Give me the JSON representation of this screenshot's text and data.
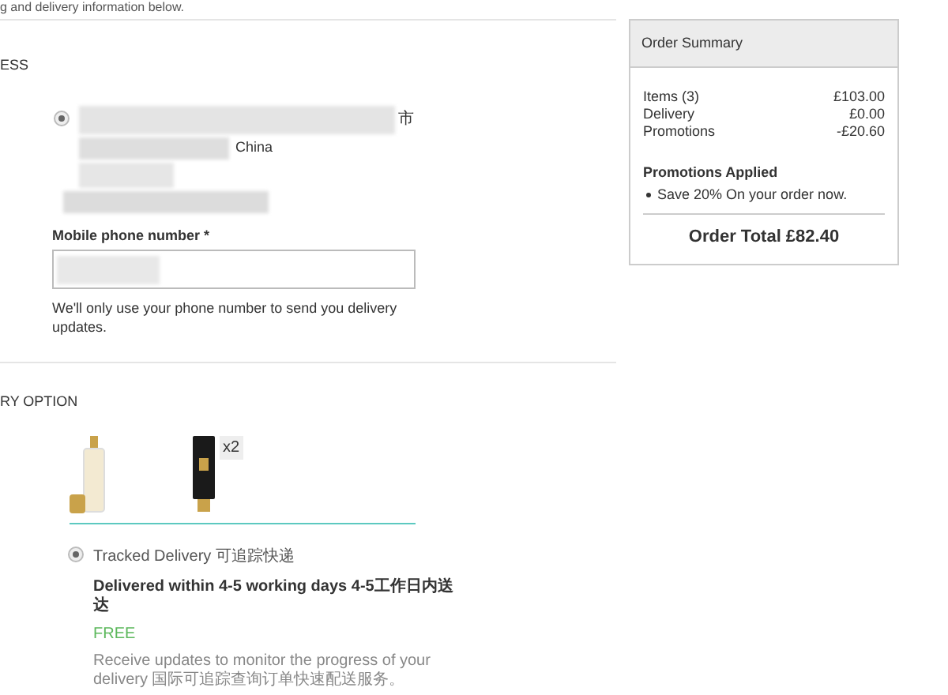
{
  "intro": "g and delivery information below.",
  "address_section": {
    "heading": "ESS",
    "address": {
      "selected": true,
      "city_fragment": "市",
      "country": "China"
    },
    "phone": {
      "label": "Mobile phone number *",
      "note": "We'll only use your phone number to send you delivery updates."
    }
  },
  "delivery_section": {
    "heading": "RY OPTION",
    "products": [
      {
        "kind": "bottle"
      },
      {
        "kind": "tube",
        "quantity": "x2"
      }
    ],
    "options": [
      {
        "selected": true,
        "name": "Tracked Delivery 可追踪快递",
        "timing": "Delivered within 4-5 working days 4-5工作日内送达",
        "price": "FREE",
        "description": "Receive updates to monitor the progress of your delivery 国际可追踪查询订单快速配送服务。"
      }
    ]
  },
  "summary": {
    "title": "Order Summary",
    "lines": [
      {
        "label": "Items (3)",
        "value": "£103.00"
      },
      {
        "label": "Delivery",
        "value": "£0.00"
      },
      {
        "label": "Promotions",
        "value": "-£20.60"
      }
    ],
    "promotions_heading": "Promotions Applied",
    "promotions": [
      "Save 20% On your order now."
    ],
    "total": "Order Total £82.40"
  }
}
